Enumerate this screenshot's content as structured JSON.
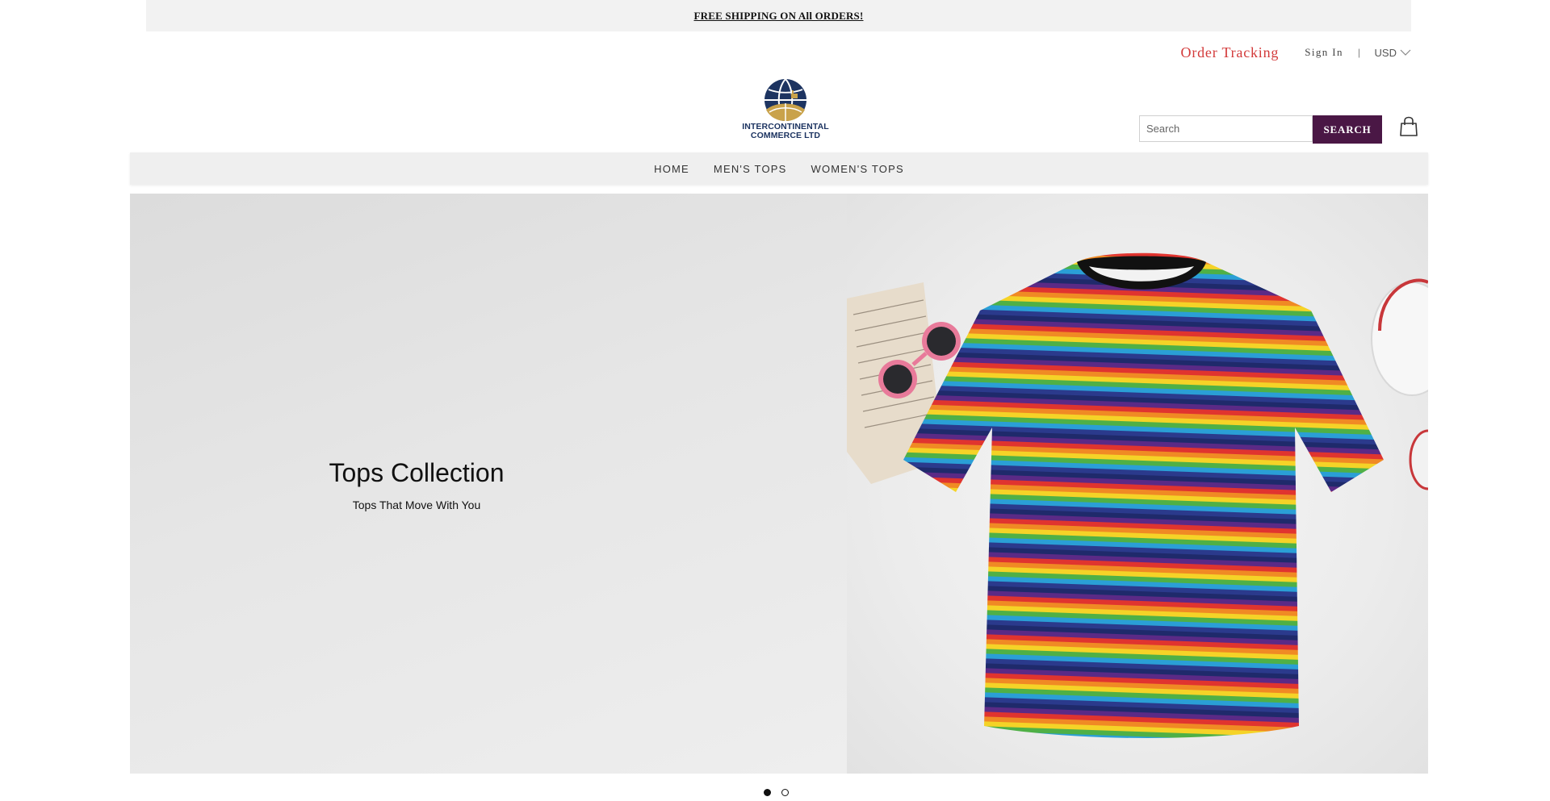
{
  "promo": {
    "text": "FREE SHIPPING ON All ORDERS!"
  },
  "header": {
    "order_tracking": "Order Tracking",
    "sign_in": "Sign In",
    "divider": "|",
    "currency": "USD",
    "logo_line1": "INTERCONTINENTAL",
    "logo_line2": "COMMERCE LTD"
  },
  "search": {
    "placeholder": "Search",
    "value": "",
    "button_label": "SEARCH"
  },
  "nav": {
    "items": [
      "HOME",
      "MEN'S TOPS",
      "WOMEN'S TOPS"
    ]
  },
  "hero": {
    "title": "Tops Collection",
    "subtitle": "Tops That Move With You",
    "slide_count": 2,
    "active_slide": 1
  },
  "colors": {
    "accent": "#4a1745",
    "order_tracking": "#d33a3a",
    "logo_navy": "#1d3461",
    "logo_gold": "#c9a24a"
  },
  "icons": [
    "chevron-down-icon",
    "shopping-bag-icon",
    "globe-logo-icon"
  ]
}
